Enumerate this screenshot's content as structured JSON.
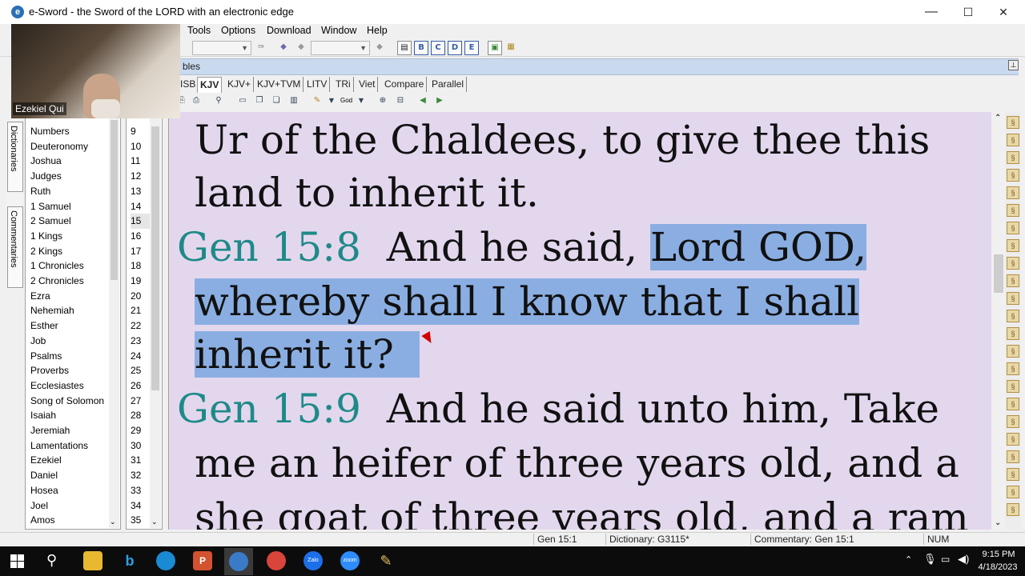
{
  "window": {
    "title": "e-Sword - the Sword of the LORD with an electronic edge",
    "minimize": "—",
    "maximize": "☐",
    "close": "✕"
  },
  "menu": [
    "Tools",
    "Options",
    "Download",
    "Window",
    "Help"
  ],
  "toolbar": {
    "letter_buttons": [
      "B",
      "C",
      "D",
      "E"
    ]
  },
  "bible_panel": {
    "header": "bles",
    "tabs": [
      "ISB",
      "KJV",
      "KJV+",
      "KJV+TVM",
      "LITV",
      "TRi",
      "Viet",
      "Compare",
      "Parallel"
    ],
    "active_tab": "KJV",
    "font_label": "God"
  },
  "sidebar": {
    "vertical_tabs": [
      "Dictionaries",
      "Commentaries"
    ],
    "books": [
      "Numbers",
      "Deuteronomy",
      "Joshua",
      "Judges",
      "Ruth",
      "1 Samuel",
      "2 Samuel",
      "1 Kings",
      "2 Kings",
      "1 Chronicles",
      "2 Chronicles",
      "Ezra",
      "Nehemiah",
      "Esther",
      "Job",
      "Psalms",
      "Proverbs",
      "Ecclesiastes",
      "Song of Solomon",
      "Isaiah",
      "Jeremiah",
      "Lamentations",
      "Ezekiel",
      "Daniel",
      "Hosea",
      "Joel",
      "Amos"
    ],
    "chapters": [
      "9",
      "10",
      "11",
      "12",
      "13",
      "14",
      "15",
      "16",
      "17",
      "18",
      "19",
      "20",
      "21",
      "22",
      "23",
      "24",
      "25",
      "26",
      "27",
      "28",
      "29",
      "30",
      "31",
      "32",
      "33",
      "34",
      "35"
    ],
    "selected_chapter": "15"
  },
  "verses": {
    "line1": "Ur of the Chaldees, to give thee this",
    "line2": "land to inherit it.",
    "v8_ref": "Gen 15:8",
    "v8_text_plain": "And he said, ",
    "v8_text_hl1": "Lord GOD,",
    "v8_line2": "whereby shall I know that I shall",
    "v8_line3": "inherit it?",
    "v9_ref": "Gen 15:9",
    "v9_text": "And he said unto him, Take",
    "v9_line2": "me an heifer of three years old, and a",
    "v9_line3": "she goat of three years old, and a ram"
  },
  "webcam": {
    "name": "Ezekiel Qui"
  },
  "status": {
    "verse": "Gen 15:1",
    "dictionary": "Dictionary: G3115*",
    "commentary": "Commentary: Gen 15:1",
    "num": "NUM"
  },
  "taskbar": {
    "time": "9:15 PM",
    "date": "4/18/2023"
  },
  "colors": {
    "reference": "#1e8a88",
    "highlight": "#8aaee2",
    "pane_background": "#e3d7ee"
  }
}
